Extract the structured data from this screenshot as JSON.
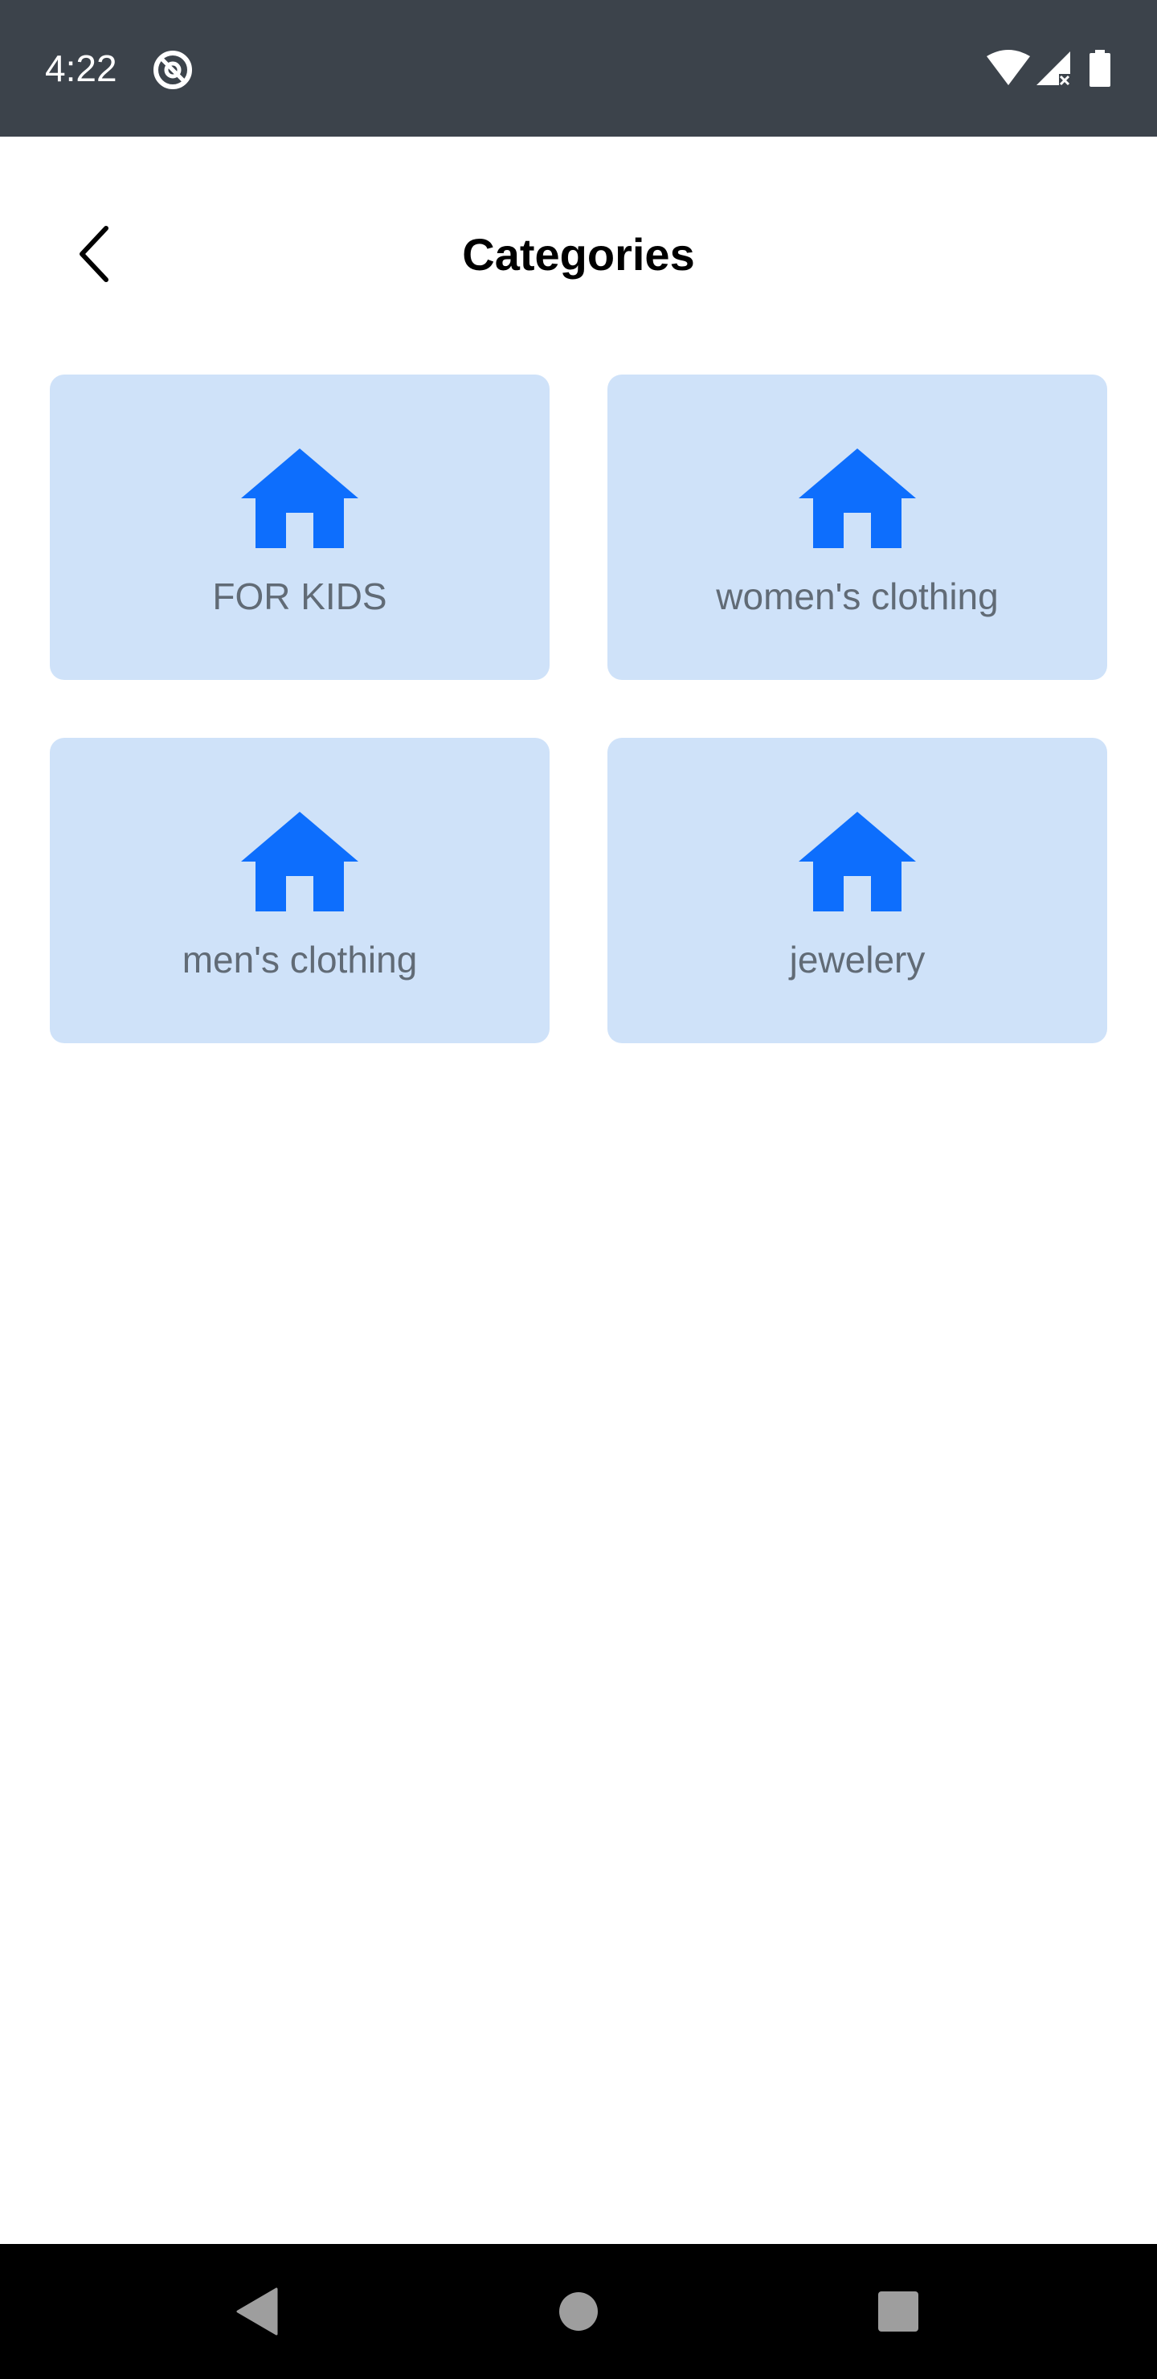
{
  "status_bar": {
    "time": "4:22",
    "icons": [
      "app-notification-icon",
      "wifi-icon",
      "cellular-signal-icon",
      "battery-icon"
    ],
    "background": "#3c434b"
  },
  "header": {
    "title": "Categories",
    "back_icon": "chevron-left-icon"
  },
  "categories": [
    {
      "label": "FOR KIDS",
      "icon": "home-icon"
    },
    {
      "label": "women's clothing",
      "icon": "home-icon"
    },
    {
      "label": "men's clothing",
      "icon": "home-icon"
    },
    {
      "label": "jewelery",
      "icon": "home-icon"
    }
  ],
  "nav_bar": {
    "buttons": [
      "back-triangle-icon",
      "home-circle-icon",
      "recents-square-icon"
    ]
  },
  "colors": {
    "card_background": "#cfe2f9",
    "icon_accent": "#0d6efd",
    "label_text": "#616b76",
    "title_text": "#000000",
    "nav_background": "#000000",
    "nav_icons": "#9e9e9e"
  }
}
